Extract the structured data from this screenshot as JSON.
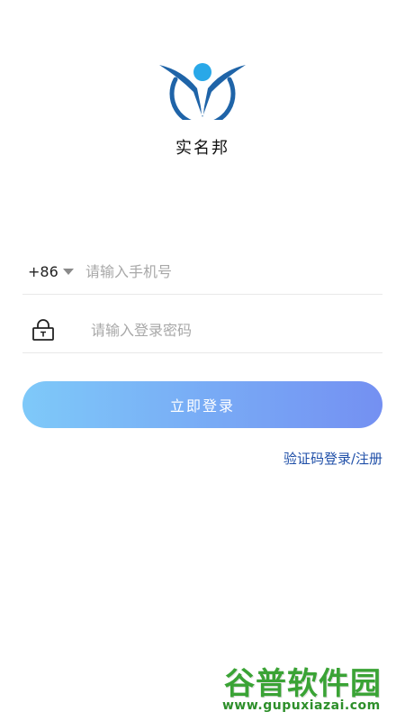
{
  "app": {
    "name": "实名邦",
    "logo": "person-circle-logo"
  },
  "colors": {
    "accent_start": "#7ec9f9",
    "accent_end": "#7490f2",
    "link": "#1f4fa8",
    "logo_blue": "#1f64a8"
  },
  "login_form": {
    "country_code": "+86",
    "phone_placeholder": "请输入手机号",
    "password_placeholder": "请输入登录密码",
    "submit_label": "立即登录",
    "alt_link": "验证码登录/注册"
  },
  "watermark": {
    "title": "谷普软件园",
    "url": "www.gupuxiazai.com"
  }
}
